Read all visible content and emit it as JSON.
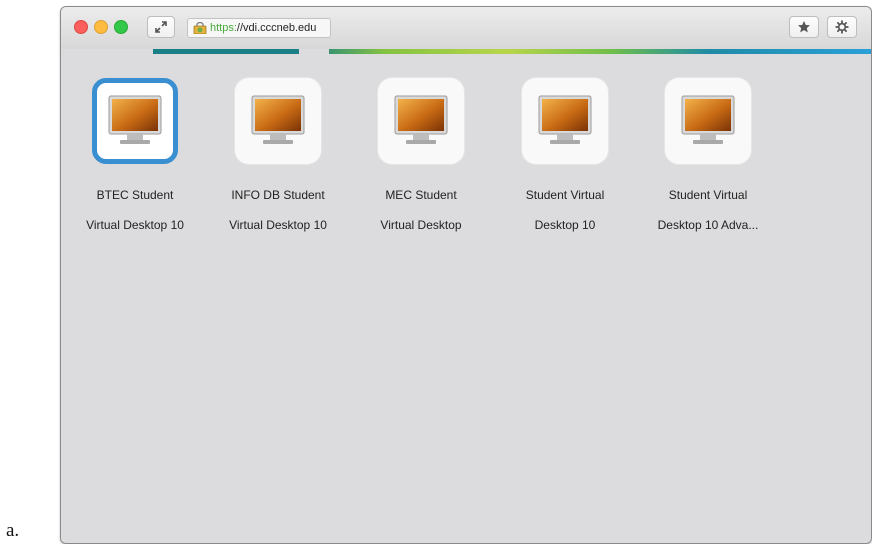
{
  "page": {
    "list_marker": "a."
  },
  "browser": {
    "url_scheme": "https:",
    "url_rest": "//vdi.cccneb.edu",
    "colors": {
      "close": "#fc605c",
      "minimize": "#fdbc40",
      "zoom": "#34c84a",
      "selection": "#3a8fd0"
    }
  },
  "desktops": [
    {
      "line1": "BTEC Student",
      "line2": "Virtual Desktop 10",
      "selected": true,
      "icon": "monitor-icon"
    },
    {
      "line1": "INFO DB Student",
      "line2": "Virtual Desktop 10",
      "selected": false,
      "icon": "monitor-icon"
    },
    {
      "line1": "MEC Student",
      "line2": "Virtual Desktop",
      "selected": false,
      "icon": "monitor-icon"
    },
    {
      "line1": "Student Virtual",
      "line2": "Desktop 10",
      "selected": false,
      "icon": "monitor-icon"
    },
    {
      "line1": "Student Virtual",
      "line2": "Desktop 10 Adva...",
      "selected": false,
      "icon": "monitor-icon"
    }
  ]
}
